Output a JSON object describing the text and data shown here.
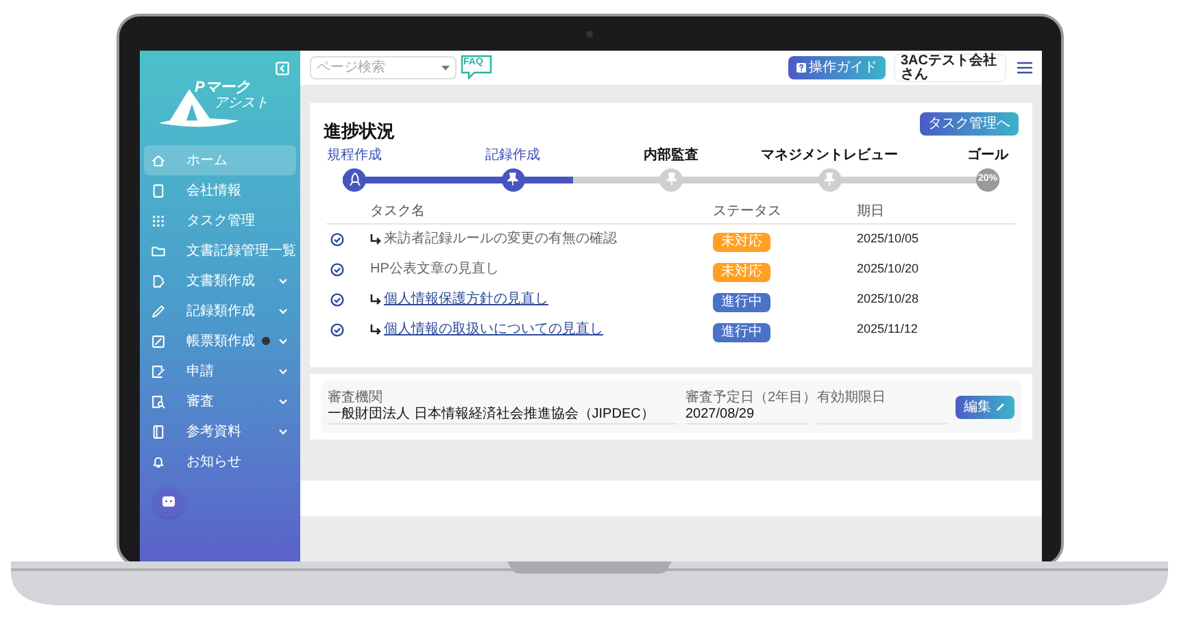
{
  "sidebar": {
    "logo": {
      "title": "Pマーク",
      "subtitle": "アシスト"
    },
    "items": [
      {
        "label": "ホーム",
        "selected": true,
        "has_submenu": false,
        "alert": false
      },
      {
        "label": "会社情報",
        "selected": false,
        "has_submenu": false,
        "alert": false
      },
      {
        "label": "タスク管理",
        "selected": false,
        "has_submenu": false,
        "alert": false
      },
      {
        "label": "文書記録管理一覧",
        "selected": false,
        "has_submenu": false,
        "alert": false
      },
      {
        "label": "文書類作成",
        "selected": false,
        "has_submenu": true,
        "alert": false
      },
      {
        "label": "記録類作成",
        "selected": false,
        "has_submenu": true,
        "alert": false
      },
      {
        "label": "帳票類作成",
        "selected": false,
        "has_submenu": true,
        "alert": true
      },
      {
        "label": "申請",
        "selected": false,
        "has_submenu": true,
        "alert": false
      },
      {
        "label": "審査",
        "selected": false,
        "has_submenu": true,
        "alert": false
      },
      {
        "label": "参考資料",
        "selected": false,
        "has_submenu": true,
        "alert": false
      },
      {
        "label": "お知らせ",
        "selected": false,
        "has_submenu": false,
        "alert": false
      }
    ]
  },
  "header": {
    "search": {
      "placeholder": "ページ検索"
    },
    "faq_label": "FAQ",
    "guide_button": "操作ガイド",
    "user": "3ACテスト会社さん"
  },
  "progress": {
    "title": "進捗状況",
    "task_button": "タスク管理へ",
    "level": 0.35,
    "steps": [
      {
        "label": "規程作成",
        "reached": true,
        "kind": "start"
      },
      {
        "label": "記録作成",
        "reached": true,
        "kind": "pin"
      },
      {
        "label": "内部監査",
        "reached": false,
        "kind": "pin"
      },
      {
        "label": "マネジメントレビュー",
        "reached": false,
        "kind": "pin"
      },
      {
        "label": "ゴール",
        "reached": false,
        "kind": "goal",
        "value": "20%"
      }
    ]
  },
  "tasks": {
    "columns": [
      "タスク名",
      "ステータス",
      "期日"
    ],
    "rows": [
      {
        "name": "来訪者記録ルールの変更の有無の確認",
        "subtask": true,
        "link": false,
        "status": "未対応",
        "color": "#ffa024",
        "due": "2025/10/05"
      },
      {
        "name": "HP公表文章の見直し",
        "subtask": false,
        "link": false,
        "status": "未対応",
        "color": "#ffa024",
        "due": "2025/10/20"
      },
      {
        "name": "個人情報保護方針の見直し",
        "subtask": true,
        "link": true,
        "status": "進行中",
        "color": "#4a72c6",
        "due": "2025/10/28"
      },
      {
        "name": "個人情報の取扱いについての見直し",
        "subtask": true,
        "link": true,
        "status": "進行中",
        "color": "#4a72c6",
        "due": "2025/11/12"
      }
    ]
  },
  "review": {
    "fields": [
      {
        "label": "審査機関",
        "value": "一般財団法人 日本情報経済社会推進協会（JIPDEC）"
      },
      {
        "label": "審査予定日（2年目）",
        "value": "2027/08/29"
      },
      {
        "label": "有効期限日"
      }
    ],
    "edit_button": "編集"
  }
}
